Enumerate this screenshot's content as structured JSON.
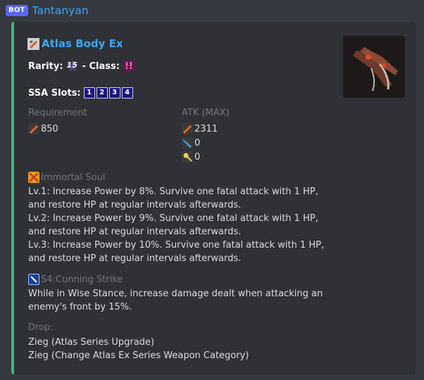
{
  "header": {
    "bot_tag": "BOT",
    "username": "Tantanyan"
  },
  "colors": {
    "accent_bar": "#43b581",
    "link_blue": "#3ba6f0",
    "bot_tag": "#5865f2"
  },
  "embed": {
    "title": "Atlas Body Ex",
    "rarity_label": "Rarity:",
    "rarity_icon_text": "15",
    "class_sep": "- Class:",
    "class_icon": "double-exclamation-icon",
    "ssa_label": "SSA Slots:",
    "ssa_slots": [
      "1",
      "2",
      "3",
      "4"
    ],
    "requirement_label": "Requirement",
    "requirement_value": "850",
    "atk_label": "ATK (MAX)",
    "atk_values": [
      "2311",
      "0",
      "0"
    ],
    "potential_name": "Immortal Soul",
    "potential_lines": [
      "Lv.1: Increase Power by 8%. Survive one fatal attack with 1 HP, and restore HP at regular intervals afterwards.",
      "Lv.2: Increase Power by 9%. Survive one fatal attack with 1 HP, and restore HP at regular intervals afterwards.",
      "Lv.3: Increase Power by 10%. Survive one fatal attack with 1 HP, and restore HP at regular intervals afterwards."
    ],
    "ability_name": "S4:Cunning Strike",
    "ability_desc": "While in Wise Stance, increase damage dealt when attacking an enemy's front by 15%.",
    "drop_label": "Drop:",
    "drops": [
      "Zieg (Atlas Series Upgrade)",
      "Zieg (Change Atlas Ex Series Weapon Category)"
    ]
  }
}
